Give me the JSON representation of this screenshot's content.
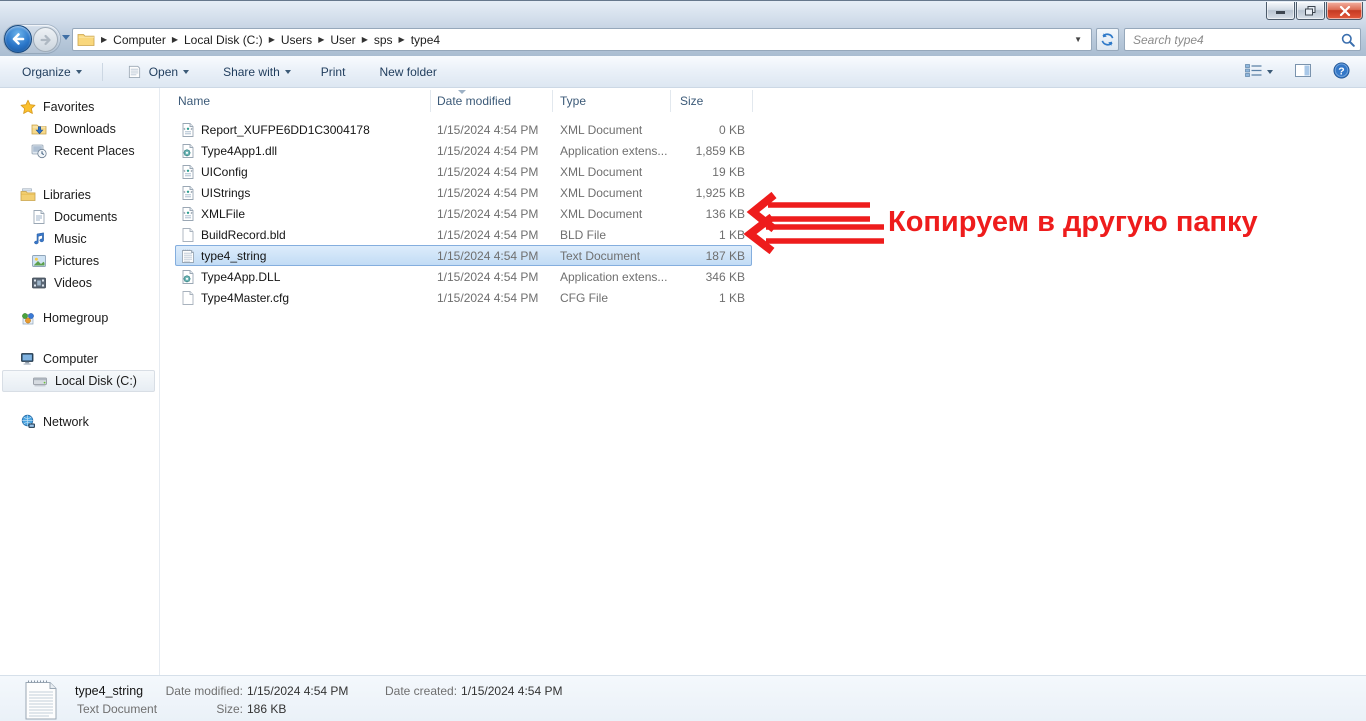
{
  "window": {
    "controls": {
      "minimize": "minimize",
      "restore": "restore",
      "close": "close"
    }
  },
  "address": {
    "breadcrumb": [
      "Computer",
      "Local Disk (C:)",
      "Users",
      "User",
      "sps",
      "type4"
    ],
    "search_placeholder": "Search type4"
  },
  "toolbar": {
    "organize": "Organize",
    "open": "Open",
    "share_with": "Share with",
    "print": "Print",
    "new_folder": "New folder"
  },
  "icons": {
    "back": "back-arrow-circle",
    "forward": "forward-arrow-circle",
    "refresh": "refresh-arrows",
    "search": "magnifier",
    "views": "change-view-list",
    "preview": "preview-pane",
    "help": "question-mark-circle",
    "address_folder": "folder"
  },
  "sidebar": {
    "groups": [
      {
        "label": "Favorites",
        "icon": "star",
        "children": [
          {
            "label": "Downloads",
            "icon": "downloads"
          },
          {
            "label": "Recent Places",
            "icon": "recent"
          }
        ]
      },
      {
        "label": "Libraries",
        "icon": "libraries",
        "children": [
          {
            "label": "Documents",
            "icon": "documents"
          },
          {
            "label": "Music",
            "icon": "music"
          },
          {
            "label": "Pictures",
            "icon": "pictures"
          },
          {
            "label": "Videos",
            "icon": "videos"
          }
        ]
      },
      {
        "label": "Homegroup",
        "icon": "homegroup",
        "children": []
      },
      {
        "label": "Computer",
        "icon": "computer",
        "children": [
          {
            "label": "Local Disk (C:)",
            "icon": "disk",
            "selected": true
          }
        ]
      },
      {
        "label": "Network",
        "icon": "network",
        "children": []
      }
    ]
  },
  "file_list": {
    "columns": [
      "Name",
      "Date modified",
      "Type",
      "Size"
    ],
    "sort_indicator_column": "Date modified",
    "rows": [
      {
        "name": "Report_XUFPE6DD1C3004178",
        "date": "1/15/2024 4:54 PM",
        "type": "XML Document",
        "size": "0 KB",
        "icon": "xml"
      },
      {
        "name": "Type4App1.dll",
        "date": "1/15/2024 4:54 PM",
        "type": "Application extens...",
        "size": "1,859 KB",
        "icon": "dll"
      },
      {
        "name": "UIConfig",
        "date": "1/15/2024 4:54 PM",
        "type": "XML Document",
        "size": "19 KB",
        "icon": "xml"
      },
      {
        "name": "UIStrings",
        "date": "1/15/2024 4:54 PM",
        "type": "XML Document",
        "size": "1,925 KB",
        "icon": "xml"
      },
      {
        "name": "XMLFile",
        "date": "1/15/2024 4:54 PM",
        "type": "XML Document",
        "size": "136 KB",
        "icon": "xml"
      },
      {
        "name": "BuildRecord.bld",
        "date": "1/15/2024 4:54 PM",
        "type": "BLD File",
        "size": "1 KB",
        "icon": "file"
      },
      {
        "name": "type4_string",
        "date": "1/15/2024 4:54 PM",
        "type": "Text Document",
        "size": "187 KB",
        "icon": "text",
        "selected": true
      },
      {
        "name": "Type4App.DLL",
        "date": "1/15/2024 4:54 PM",
        "type": "Application extens...",
        "size": "346 KB",
        "icon": "dll"
      },
      {
        "name": "Type4Master.cfg",
        "date": "1/15/2024 4:54 PM",
        "type": "CFG File",
        "size": "1 KB",
        "icon": "file"
      }
    ]
  },
  "annotation": {
    "text": "Копируем в другую папку",
    "color": "#ee1c1c"
  },
  "details": {
    "file_name": "type4_string",
    "file_type": "Text Document",
    "date_modified_label": "Date modified:",
    "date_modified": "1/15/2024 4:54 PM",
    "size_label": "Size:",
    "size": "186 KB",
    "date_created_label": "Date created:",
    "date_created": "1/15/2024 4:54 PM"
  },
  "colors": {
    "annotation_red": "#ee1c1c",
    "selection_border": "#84aede",
    "selection_fill": "#c2dcf5"
  }
}
